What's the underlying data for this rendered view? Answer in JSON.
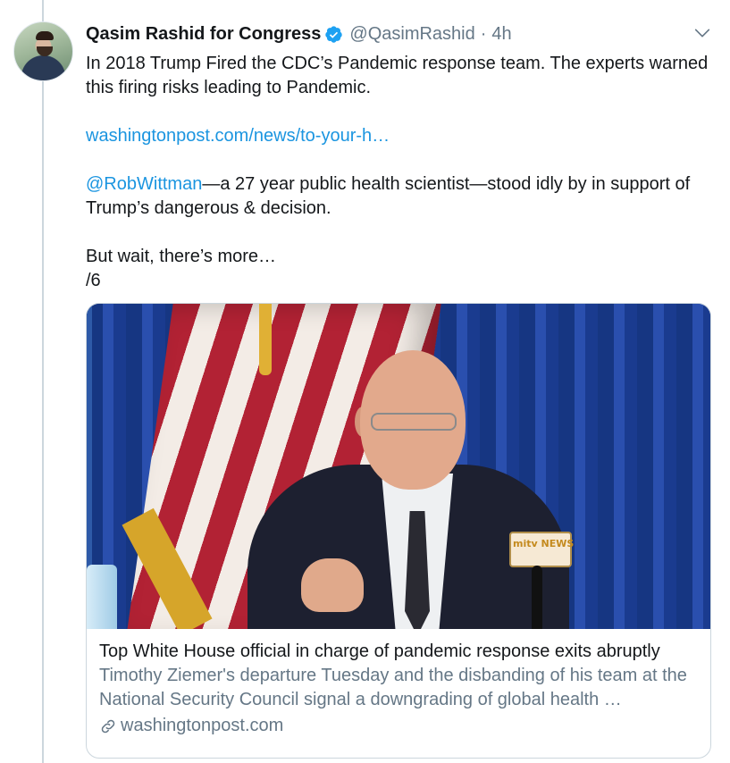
{
  "tweet": {
    "author_name": "Qasim Rashid for Congress",
    "handle": "@QasimRashid",
    "separator": "·",
    "time": "4h",
    "lines": {
      "p1": "In 2018 Trump Fired the CDC’s Pandemic response team. The experts warned this firing risks leading to Pandemic.",
      "link": "washingtonpost.com/news/to-your-h…",
      "mention": "@RobWittman",
      "p3_rest": "—a 27 year public health scientist—stood idly by in support of Trump’s dangerous & decision.",
      "p4": "But wait, there’s more…",
      "p5": "/6"
    }
  },
  "card": {
    "image_caption_logo": "mitv NEWS",
    "title": "Top White House official in charge of pandemic response exits abruptly",
    "description": "Timothy Ziemer's departure Tuesday and the disbanding of his team at the National Security Council signal a downgrading of global health …",
    "domain": "washingtonpost.com"
  },
  "icons": {
    "verified": "verified-badge-icon",
    "chevron": "chevron-down-icon",
    "link": "link-icon"
  },
  "colors": {
    "link": "#1b95e0",
    "secondary_text": "#657786",
    "verified": "#1da1f2"
  }
}
